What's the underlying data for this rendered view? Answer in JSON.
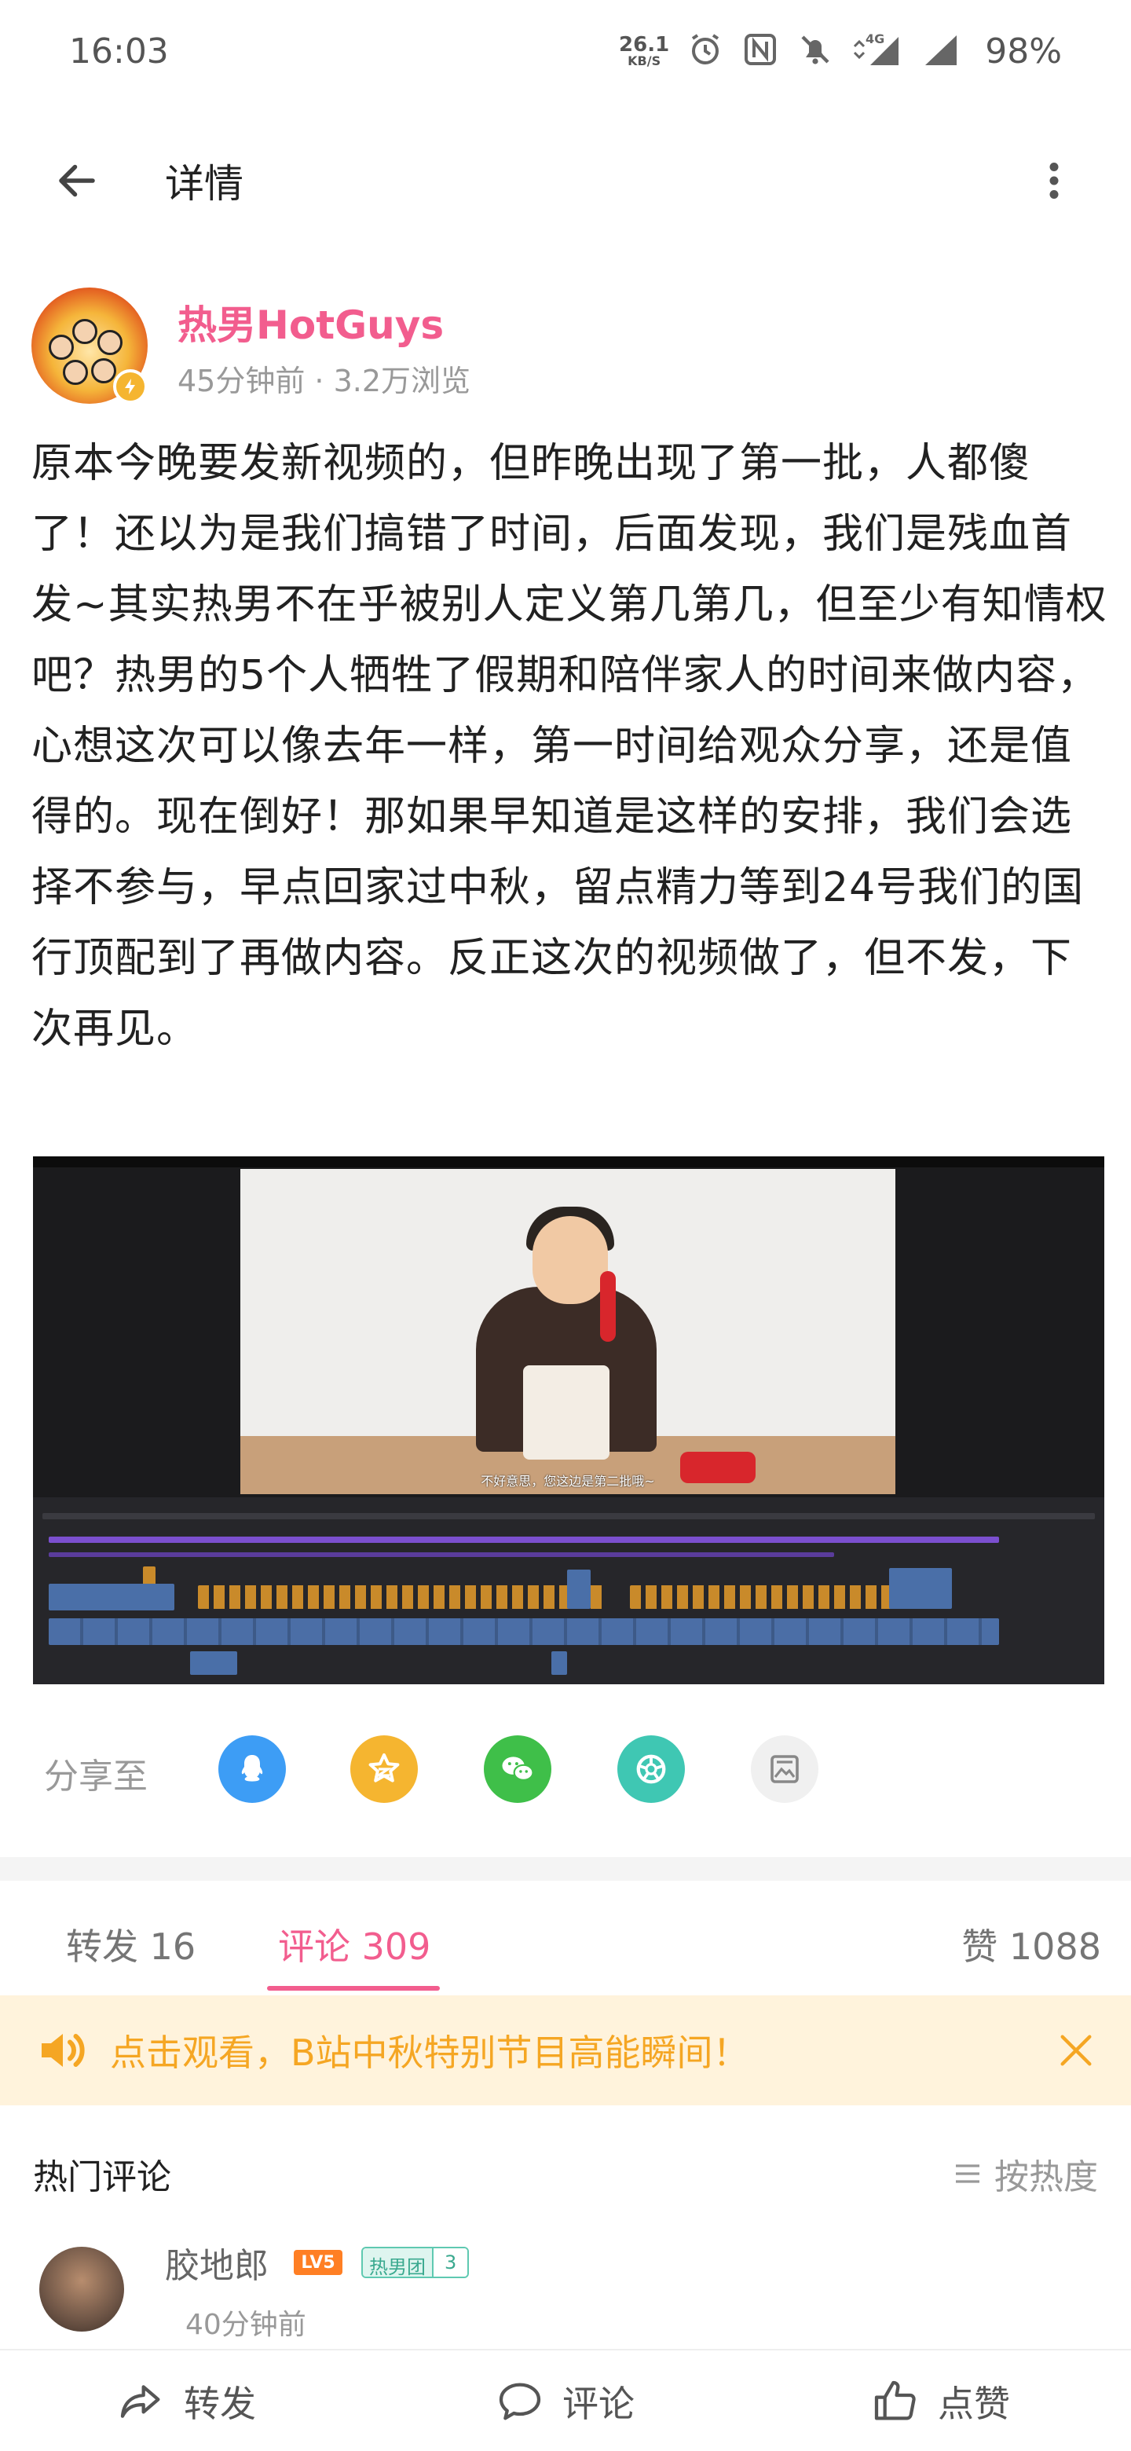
{
  "status_bar": {
    "time": "16:03",
    "net_speed_value": "26.1",
    "net_speed_unit": "KB/S",
    "network": "4G",
    "battery": "98%"
  },
  "header": {
    "title": "详情"
  },
  "author": {
    "name": "热男HotGuys",
    "meta": "45分钟前 · 3.2万浏览"
  },
  "post": {
    "text": "原本今晚要发新视频的，但昨晚出现了第一批，人都傻了！还以为是我们搞错了时间，后面发现，我们是残血首发~其实热男不在乎被别人定义第几第几，但至少有知情权吧？热男的5个人牺牲了假期和陪伴家人的时间来做内容，心想这次可以像去年一样，第一时间给观众分享，还是值得的。现在倒好！那如果早知道是这样的安排，我们会选择不参与，早点回家过中秋，留点精力等到24号我们的国行顶配到了再做内容。反正这次的视频做了，但不发，下次再见。",
    "image_subtitle": "不好意思，您这边是第二批哦~"
  },
  "share": {
    "label": "分享至",
    "targets": [
      "qq-icon",
      "qzone-icon",
      "wechat-icon",
      "moments-icon",
      "image-share-icon"
    ],
    "colors": [
      "#3d9df5",
      "#f5b530",
      "#3fbf49",
      "#3fc7b3",
      "#f0f0f0"
    ]
  },
  "tabs": {
    "repost": "转发 16",
    "comments": "评论 309",
    "likes": "赞 1088"
  },
  "banner": {
    "text": "点击观看，B站中秋特别节目高能瞬间！"
  },
  "comments_section": {
    "title": "热门评论",
    "sort_label": "按热度",
    "items": [
      {
        "user": "胶地郎",
        "level": "LV5",
        "fan_badge_label": "热男团",
        "fan_badge_level": "3",
        "time": "40分钟前"
      }
    ]
  },
  "bottom_bar": {
    "repost": "转发",
    "comment": "评论",
    "like": "点赞"
  },
  "colors": {
    "accent_pink": "#f25d8e",
    "banner_bg": "#fff3dc",
    "banner_text": "#f5a623"
  }
}
